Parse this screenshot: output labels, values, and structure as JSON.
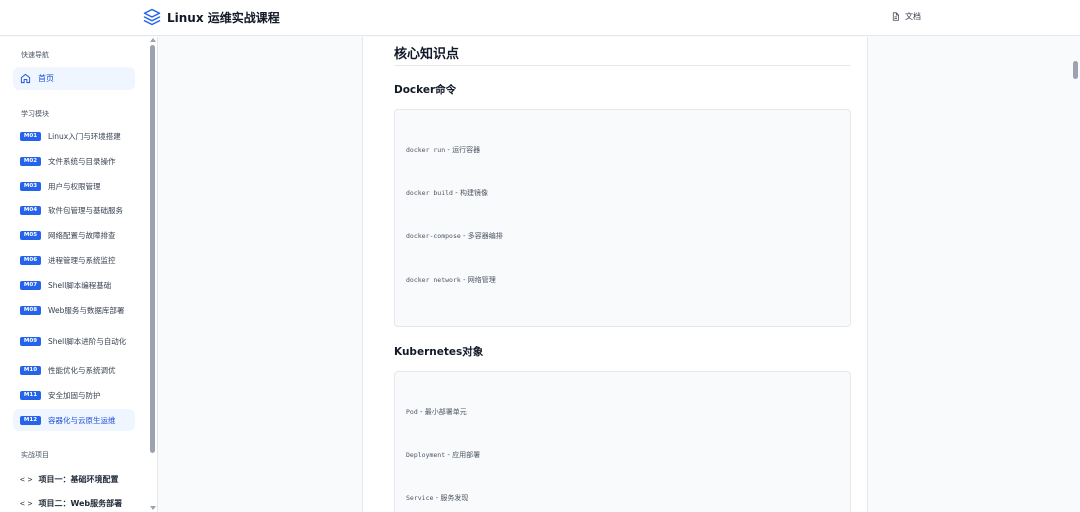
{
  "header": {
    "title": "Linux 运维实战课程",
    "docs_label": "文档",
    "logo_icon": "layers-icon",
    "docs_icon": "document-icon"
  },
  "sidebar": {
    "quick_nav_label": "快速导航",
    "home_label": "首页",
    "home_icon": "home-icon",
    "modules_label": "学习模块",
    "modules": [
      {
        "badge": "M01",
        "label": "Linux入门与环境搭建"
      },
      {
        "badge": "M02",
        "label": "文件系统与目录操作"
      },
      {
        "badge": "M03",
        "label": "用户与权限管理"
      },
      {
        "badge": "M04",
        "label": "软件包管理与基础服务"
      },
      {
        "badge": "M05",
        "label": "网络配置与故障排查"
      },
      {
        "badge": "M06",
        "label": "进程管理与系统监控"
      },
      {
        "badge": "M07",
        "label": "Shell脚本编程基础"
      },
      {
        "badge": "M08",
        "label": "Web服务与数据库部署"
      },
      {
        "badge": "M09",
        "label": "Shell脚本进阶与自动化"
      },
      {
        "badge": "M10",
        "label": "性能优化与系统调优"
      },
      {
        "badge": "M11",
        "label": "安全加固与防护"
      },
      {
        "badge": "M12",
        "label": "容器化与云原生运维"
      }
    ],
    "active_module": "M12",
    "projects_label": "实战项目",
    "projects": [
      {
        "icon": "code-icon",
        "label": "项目一：基础环境配置"
      },
      {
        "icon": "code-icon",
        "label": "项目二：Web服务部署"
      }
    ]
  },
  "content": {
    "heading": "核心知识点",
    "sections": [
      {
        "title": "Docker命令",
        "items": [
          {
            "cmd": "docker run",
            "desc": " - 运行容器"
          },
          {
            "cmd": "docker build",
            "desc": " - 构建镜像"
          },
          {
            "cmd": "docker-compose",
            "desc": " - 多容器编排"
          },
          {
            "cmd": "docker network",
            "desc": " - 网络管理"
          }
        ]
      },
      {
        "title": "Kubernetes对象",
        "items": [
          {
            "cmd": "Pod",
            "desc": " - 最小部署单元"
          },
          {
            "cmd": "Deployment",
            "desc": " - 应用部署"
          },
          {
            "cmd": "Service",
            "desc": " - 服务发现"
          }
        ]
      }
    ]
  },
  "colors": {
    "accent": "#2563eb",
    "active_bg": "#eff6ff",
    "page_bg": "#f8fafc"
  }
}
